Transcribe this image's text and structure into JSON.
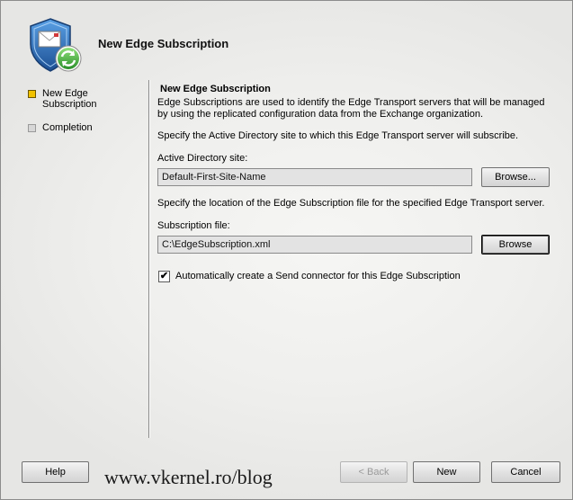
{
  "header": {
    "title": "New Edge Subscription",
    "icon": "shield-envelope-sync-icon"
  },
  "nav": {
    "items": [
      {
        "label": "New Edge Subscription",
        "state": "active"
      },
      {
        "label": "Completion",
        "state": "inactive"
      }
    ]
  },
  "main": {
    "section_title": "New Edge Subscription",
    "intro": "Edge Subscriptions are used to identify the Edge Transport servers that will be managed by using the replicated configuration data from the Exchange organization.",
    "site_instruction": "Specify the Active Directory site to which this Edge Transport server will subscribe.",
    "site_label": "Active Directory site:",
    "site_value": "Default-First-Site-Name",
    "site_browse_label": "Browse...",
    "file_instruction": "Specify the location of the Edge Subscription file for the specified Edge Transport server.",
    "file_label": "Subscription file:",
    "file_value": "C:\\EdgeSubscription.xml",
    "file_browse_label": "Browse",
    "send_connector_label": "Automatically create a Send connector for this Edge Subscription",
    "send_connector_checked": true,
    "check_glyph": "✔"
  },
  "footer": {
    "help_label": "Help",
    "back_label": "< Back",
    "next_label": "New",
    "cancel_label": "Cancel"
  },
  "watermark": "www.vkernel.ro/blog",
  "colors": {
    "active_bullet": "#f2c200",
    "shield_blue": "#2a6fb8",
    "sync_green": "#3aa83a"
  }
}
